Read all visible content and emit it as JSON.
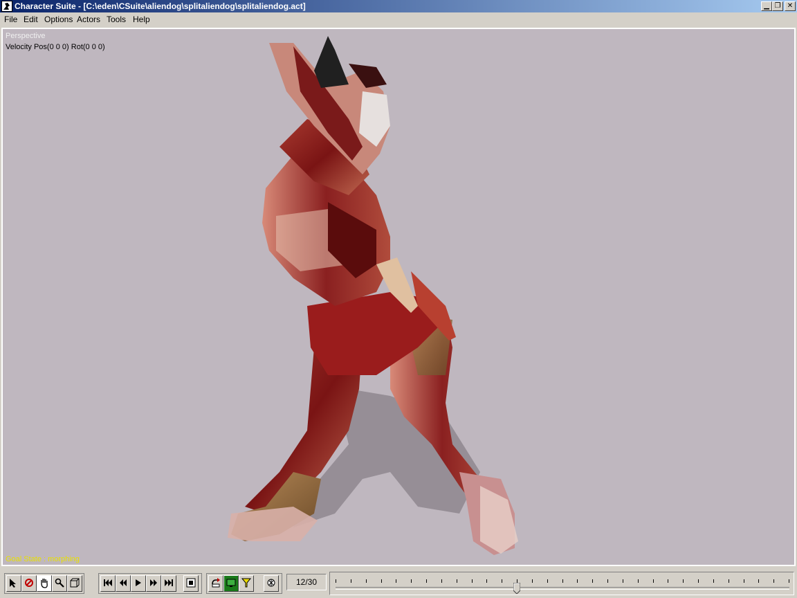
{
  "window": {
    "title": "Character Suite - [C:\\eden\\CSuite\\aliendog\\splitaliendog\\splitaliendog.act]",
    "controls": {
      "minimize": "▁",
      "restore": "❐",
      "close": "✕"
    }
  },
  "menu": {
    "items": [
      "File",
      "Edit",
      "Options",
      "Actors",
      "Tools",
      "Help"
    ]
  },
  "viewport": {
    "view_label": "Perspective",
    "velocity_label": "Velocity Pos(0 0 0) Rot(0 0 0)",
    "goal_state": "Goal State : morphing",
    "background_color": "#bfb7bf"
  },
  "toolbar": {
    "tools": [
      "select-arrow-icon",
      "rotate-icon",
      "hand-pan-icon",
      "zoom-icon",
      "box-icon"
    ],
    "playback": [
      "first-frame-icon",
      "previous-frame-icon",
      "play-icon",
      "next-frame-icon",
      "last-frame-icon",
      "keyframe-icon"
    ],
    "extras": [
      "loop-icon",
      "display-icon",
      "goal-icon",
      "settings-icon"
    ],
    "frame_counter": "12/30"
  },
  "timeline": {
    "current_frame": 12,
    "total_frames": 30
  }
}
